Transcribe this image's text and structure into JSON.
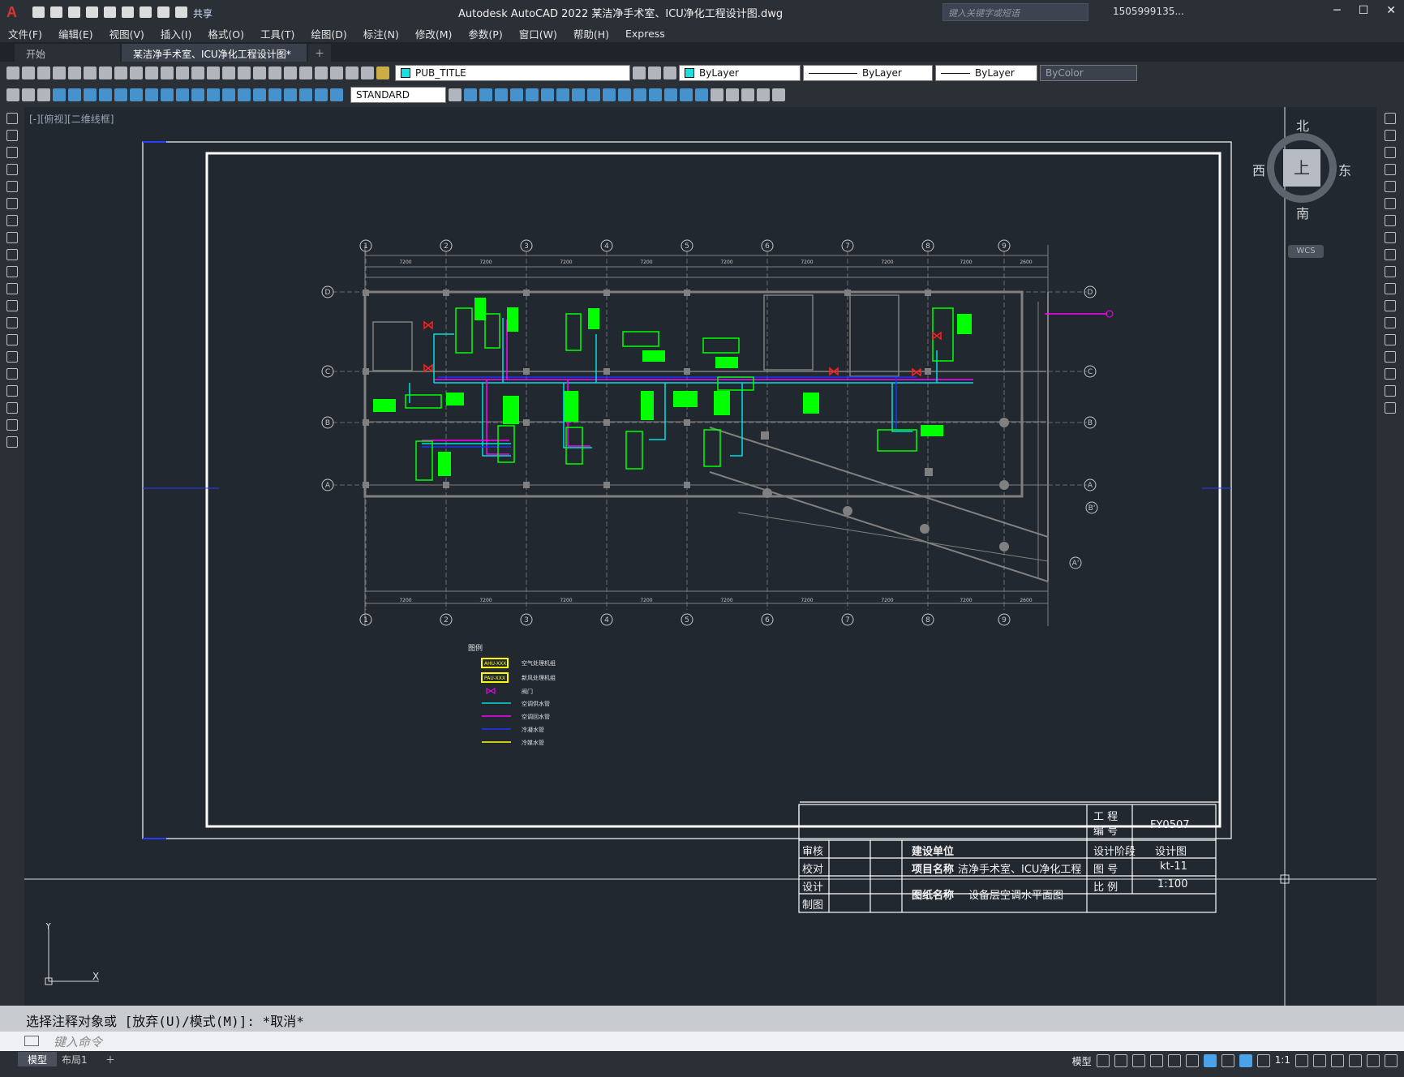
{
  "app": {
    "window_title": "Autodesk AutoCAD 2022    某洁净手术室、ICU净化工程设计图.dwg",
    "logo": "A",
    "share_label": "共享",
    "search_placeholder": "键入关键字或短语",
    "user": "1505999135...",
    "colors": {
      "bg": "#2b2f36",
      "canvas": "#212830",
      "accent": "#4aa3e8",
      "cad_green": "#00ff00",
      "cad_cyan": "#00e0e0",
      "cad_magenta": "#ff00ff",
      "cad_blue": "#1a33ff",
      "cad_gray": "#808080",
      "cad_red": "#ff2020"
    }
  },
  "menu": [
    "文件(F)",
    "编辑(E)",
    "视图(V)",
    "插入(I)",
    "格式(O)",
    "工具(T)",
    "绘图(D)",
    "标注(N)",
    "修改(M)",
    "参数(P)",
    "窗口(W)",
    "帮助(H)",
    "Express"
  ],
  "tabs": [
    {
      "label": "开始",
      "active": false
    },
    {
      "label": "某洁净手术室、ICU净化工程设计图*",
      "active": true
    }
  ],
  "properties": {
    "layer": "PUB_TITLE",
    "color": "ByLayer",
    "linetype": "ByLayer",
    "lineweight": "ByLayer",
    "plotstyle": "ByColor",
    "textstyle": "STANDARD"
  },
  "viewport": {
    "label": "[-][俯视][二维线框]",
    "compass": {
      "north": "北",
      "south": "南",
      "west": "西",
      "east": "东",
      "face": "上"
    },
    "wcs": "WCS"
  },
  "drawing": {
    "axis_top": [
      "1",
      "2",
      "3",
      "4",
      "5",
      "6",
      "7",
      "8",
      "9"
    ],
    "axis_side": [
      "D",
      "C",
      "B",
      "A"
    ],
    "axis_skew": [
      "B'",
      "A'"
    ],
    "dim_spacing": [
      "7200",
      "7200",
      "7200",
      "7200",
      "7200",
      "7200",
      "7200",
      "7200",
      "2600"
    ],
    "legend_title": "图例",
    "legend": [
      {
        "code": "AHU-XXX",
        "text": "空气处理机组"
      },
      {
        "code": "PAU-XXX",
        "text": "新风处理机组"
      },
      {
        "code": "",
        "text": "阀门"
      },
      {
        "code": "",
        "text": "空调供水管"
      },
      {
        "code": "",
        "text": "空调回水管"
      },
      {
        "code": "",
        "text": "冷凝水管"
      },
      {
        "code": "",
        "text": "冷媒水管"
      }
    ],
    "title_block": {
      "proj_no_label": "工 程\n编 号",
      "proj_no": "FY0507",
      "rows_left": [
        "审核",
        "校对",
        "设计",
        "制图"
      ],
      "client_label": "建设单位",
      "project_label": "项目名称",
      "project_name": "洁净手术室、ICU净化工程",
      "drawing_label": "图纸名称",
      "drawing_name": "设备层空调水平面图",
      "stage_label": "设计阶段",
      "stage": "设计图",
      "drawing_no_label": "图 号",
      "drawing_no": "kt-11",
      "scale_label": "比 例",
      "scale": "1:100"
    }
  },
  "command": {
    "history": "选择注释对象或 [放弃(U)/模式(M)]: *取消*",
    "placeholder": "键入命令"
  },
  "status": {
    "layout_tabs": [
      "模型",
      "布局1"
    ],
    "model_label": "模型",
    "scale": "1:1"
  }
}
